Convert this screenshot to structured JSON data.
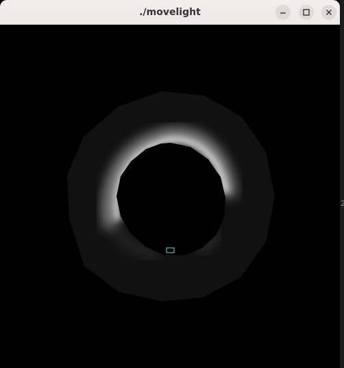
{
  "window": {
    "title": "./movelight",
    "controls": {
      "minimize_icon": "minimize-icon",
      "maximize_icon": "maximize-icon",
      "close_icon": "close-icon"
    }
  },
  "scene": {
    "background": "#000000",
    "torus_color": "#111111",
    "highlight_color": "#ffffff",
    "light_marker_color": "#6fd6d6"
  },
  "edge_glyph": "2"
}
